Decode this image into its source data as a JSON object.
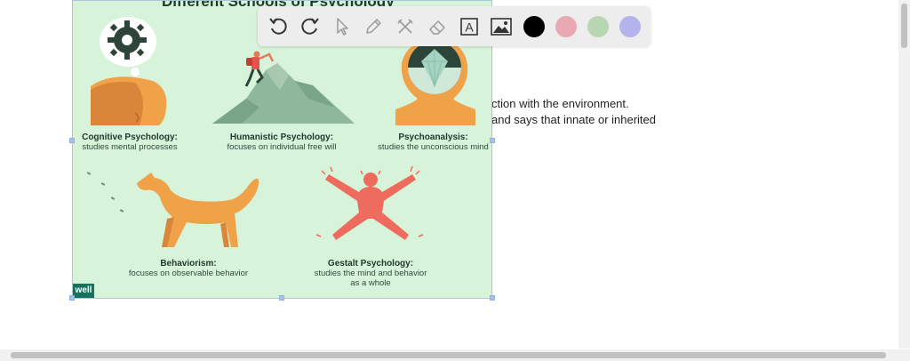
{
  "document": {
    "line1": "ction with the environment.",
    "line2": "and says that innate or inherited"
  },
  "infographic": {
    "title": "Different Schools of Psychology",
    "brand": "well",
    "items": [
      {
        "title": "Cognitive Psychology:",
        "subtitle": "studies mental processes"
      },
      {
        "title": "Humanistic Psychology:",
        "subtitle": "focuses on individual free will"
      },
      {
        "title": "Psychoanalysis:",
        "subtitle": "studies the unconscious mind"
      },
      {
        "title": "Behaviorism:",
        "subtitle": "focuses on observable behavior"
      },
      {
        "title": "Gestalt Psychology:",
        "subtitle": "studies the mind and behavior",
        "subtitle2": "as a whole"
      }
    ]
  },
  "toolbar": {
    "tools": [
      "undo-icon",
      "redo-icon",
      "pointer-icon",
      "pen-icon",
      "tools-icon",
      "eraser-icon",
      "text-icon",
      "image-icon"
    ],
    "text_tool_glyph": "A",
    "colors": [
      "#000000",
      "#e8a9b2",
      "#b7d6b1",
      "#b4b3ec"
    ]
  },
  "colors": {
    "panel_bg": "#d7f3d9",
    "illustration_orange": "#f0a249",
    "illustration_red": "#ee6c5d",
    "mountain_green": "#8fb79b"
  }
}
